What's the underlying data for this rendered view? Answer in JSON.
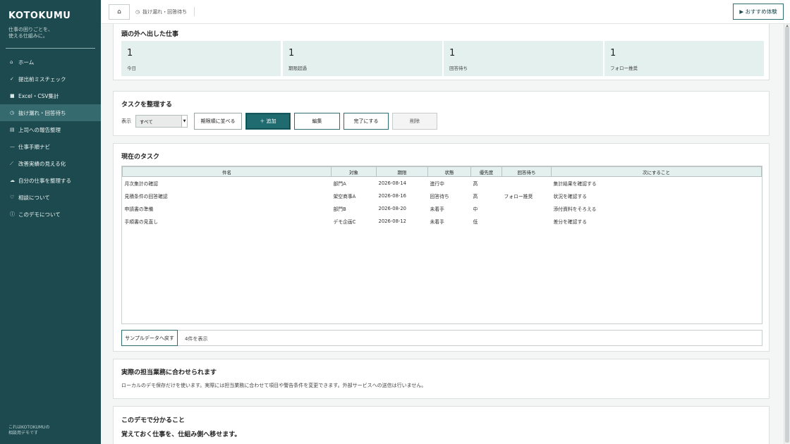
{
  "sidebar": {
    "brand": "KOTOKUMU",
    "tagline_line1": "仕事の困りごとを、",
    "tagline_line2": "使える仕組みに。",
    "items": [
      {
        "icon": "⌂",
        "icon_name": "home-icon",
        "label": "ホーム"
      },
      {
        "icon": "✓",
        "icon_name": "check-icon",
        "label": "提出前ミスチェック"
      },
      {
        "icon": "■",
        "icon_name": "spreadsheet-icon",
        "label": "Excel・CSV集計"
      },
      {
        "icon": "◷",
        "icon_name": "clock-icon",
        "label": "抜け漏れ・回答待ち"
      },
      {
        "icon": "▤",
        "icon_name": "report-icon",
        "label": "上司への報告整理"
      },
      {
        "icon": "—",
        "icon_name": "steps-icon",
        "label": "仕事手順ナビ"
      },
      {
        "icon": "⟋",
        "icon_name": "chart-line-icon",
        "label": "改善実績の見える化"
      },
      {
        "icon": "☁",
        "icon_name": "organize-icon",
        "label": "自分の仕事を整理する"
      },
      {
        "icon": "♡",
        "icon_name": "heart-icon",
        "label": "相談について"
      },
      {
        "icon": "ⓘ",
        "icon_name": "info-icon",
        "label": "このデモについて"
      }
    ],
    "active_index": 3,
    "footer_line1": "これはKOTOKUMUの",
    "footer_line2": "相談用デモです"
  },
  "topbar": {
    "home_icon": "⌂",
    "breadcrumb_icon": "◷",
    "breadcrumb": "抜け漏れ・回答待ち",
    "recommend_label": "▶ おすすめ体験"
  },
  "summary": {
    "title": "頭の外へ出した仕事",
    "metrics": [
      {
        "value": "1",
        "label": "今日"
      },
      {
        "value": "1",
        "label": "期限超過"
      },
      {
        "value": "1",
        "label": "回答待ち"
      },
      {
        "value": "1",
        "label": "フォロー推奨"
      }
    ]
  },
  "organize": {
    "title": "タスクを整理する",
    "filter_label": "表示",
    "filter_value": "すべて",
    "sort_button": "期限順に並べる",
    "add_button": "＋ 追加",
    "edit_button": "編集",
    "complete_button": "完了にする",
    "delete_button": "削除"
  },
  "current": {
    "title": "現在のタスク",
    "columns": [
      "件名",
      "対象",
      "期限",
      "状態",
      "優先度",
      "回答待ち",
      "次にすること"
    ],
    "rows": [
      [
        "月次集計の確認",
        "部門A",
        "2026-08-14",
        "進行中",
        "高",
        "",
        "集計結果を確認する"
      ],
      [
        "見積条件の回答確認",
        "架空商事A",
        "2026-08-16",
        "回答待ち",
        "高",
        "フォロー推奨",
        "状況を確認する"
      ],
      [
        "申請書の準備",
        "部門B",
        "2026-08-20",
        "未着手",
        "中",
        "",
        "添付資料をそろえる"
      ],
      [
        "手順書の見直し",
        "デモ企画C",
        "2026-08-12",
        "未着手",
        "低",
        "",
        "差分を確認する"
      ]
    ],
    "sample_button": "サンプルデータへ戻す",
    "count_label": "4件を表示"
  },
  "customize": {
    "title": "実際の担当業務に合わせられます",
    "description": "ローカルのデモ保存だけを使います。実際には担当業務に合わせて項目や警告条件を変更できます。外部サービスへの送信は行いません。"
  },
  "learn": {
    "title": "このデモで分かること",
    "subtitle": "覚えておく仕事を、仕組み側へ移せます。"
  }
}
